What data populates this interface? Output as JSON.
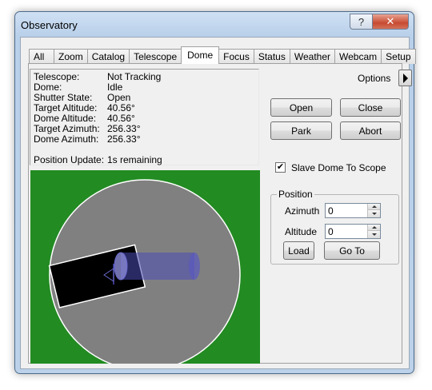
{
  "window": {
    "title": "Observatory",
    "help_label": "?",
    "close_label": "✕"
  },
  "tabs": [
    {
      "label": "All Sky",
      "active": false
    },
    {
      "label": "Zoom",
      "active": false
    },
    {
      "label": "Catalog",
      "active": false
    },
    {
      "label": "Telescope",
      "active": false
    },
    {
      "label": "Dome",
      "active": true
    },
    {
      "label": "Focus",
      "active": false
    },
    {
      "label": "Status",
      "active": false
    },
    {
      "label": "Weather",
      "active": false
    },
    {
      "label": "Webcam",
      "active": false
    },
    {
      "label": "Setup",
      "active": false
    }
  ],
  "info": {
    "telescope": {
      "key": "Telescope:",
      "value": "Not Tracking"
    },
    "dome": {
      "key": "Dome:",
      "value": "Idle"
    },
    "shutter": {
      "key": "Shutter State:",
      "value": "Open"
    },
    "target_alt": {
      "key": "Target Altitude:",
      "value": "40.56°"
    },
    "dome_alt": {
      "key": "Dome Altitude:",
      "value": "40.56°"
    },
    "target_az": {
      "key": "Target Azimuth:",
      "value": "256.33°"
    },
    "dome_az": {
      "key": "Dome Azimuth:",
      "value": "256.33°"
    },
    "position_update": {
      "key": "Position Update:",
      "value": "1s remaining"
    }
  },
  "options_label": "Options",
  "buttons": {
    "open": "Open",
    "close": "Close",
    "park": "Park",
    "abort": "Abort",
    "load": "Load",
    "goto": "Go To"
  },
  "slave": {
    "label": "Slave Dome To Scope",
    "checked": true,
    "mark": "✔"
  },
  "position": {
    "group_label": "Position",
    "azimuth_label": "Azimuth",
    "azimuth_value": "0",
    "altitude_label": "Altitude",
    "altitude_value": "0"
  },
  "colors": {
    "sky_green": "#228b22",
    "dome_gray": "#808080",
    "slit": "#000000",
    "scope": "#4b4bb4"
  }
}
